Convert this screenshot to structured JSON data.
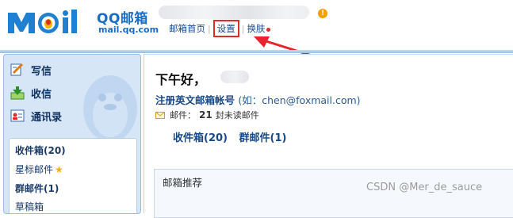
{
  "header": {
    "brand_name": "QQ邮箱",
    "brand_domain": "mail.qq.com",
    "warning_glyph": "!"
  },
  "top_nav": {
    "home_label": "邮箱首页",
    "separator": "|",
    "settings_label": "设置",
    "skin_label": "换肤"
  },
  "sidebar": {
    "compose_label": "写信",
    "receive_label": "收信",
    "contacts_label": "通讯录",
    "folders": [
      {
        "label": "收件箱(20)",
        "bold": true
      },
      {
        "label": "星标邮件",
        "bold": false,
        "icon": "star-icon"
      },
      {
        "label": "群邮件(1)",
        "bold": true
      },
      {
        "label": "草稿箱",
        "bold": false
      }
    ]
  },
  "main": {
    "greeting": "下午好，",
    "register_label": "注册英文邮箱帐号",
    "register_hint": "(如：chen@foxmail.com)",
    "mail_prefix": "邮件：",
    "unread_count": "21",
    "mail_suffix": "封未读邮件",
    "inbox_link": "收件箱(20)",
    "group_link": "群邮件(1)",
    "recommend_title": "邮箱推荐"
  },
  "watermark": "CSDN @Mer_de_sauce",
  "colors": {
    "accent_blue": "#1a6cc4",
    "link_blue": "#17488a",
    "highlight_red": "#e02b2b",
    "sidebar_bg": "#d6e6f7",
    "warning_orange": "#f0a100"
  }
}
